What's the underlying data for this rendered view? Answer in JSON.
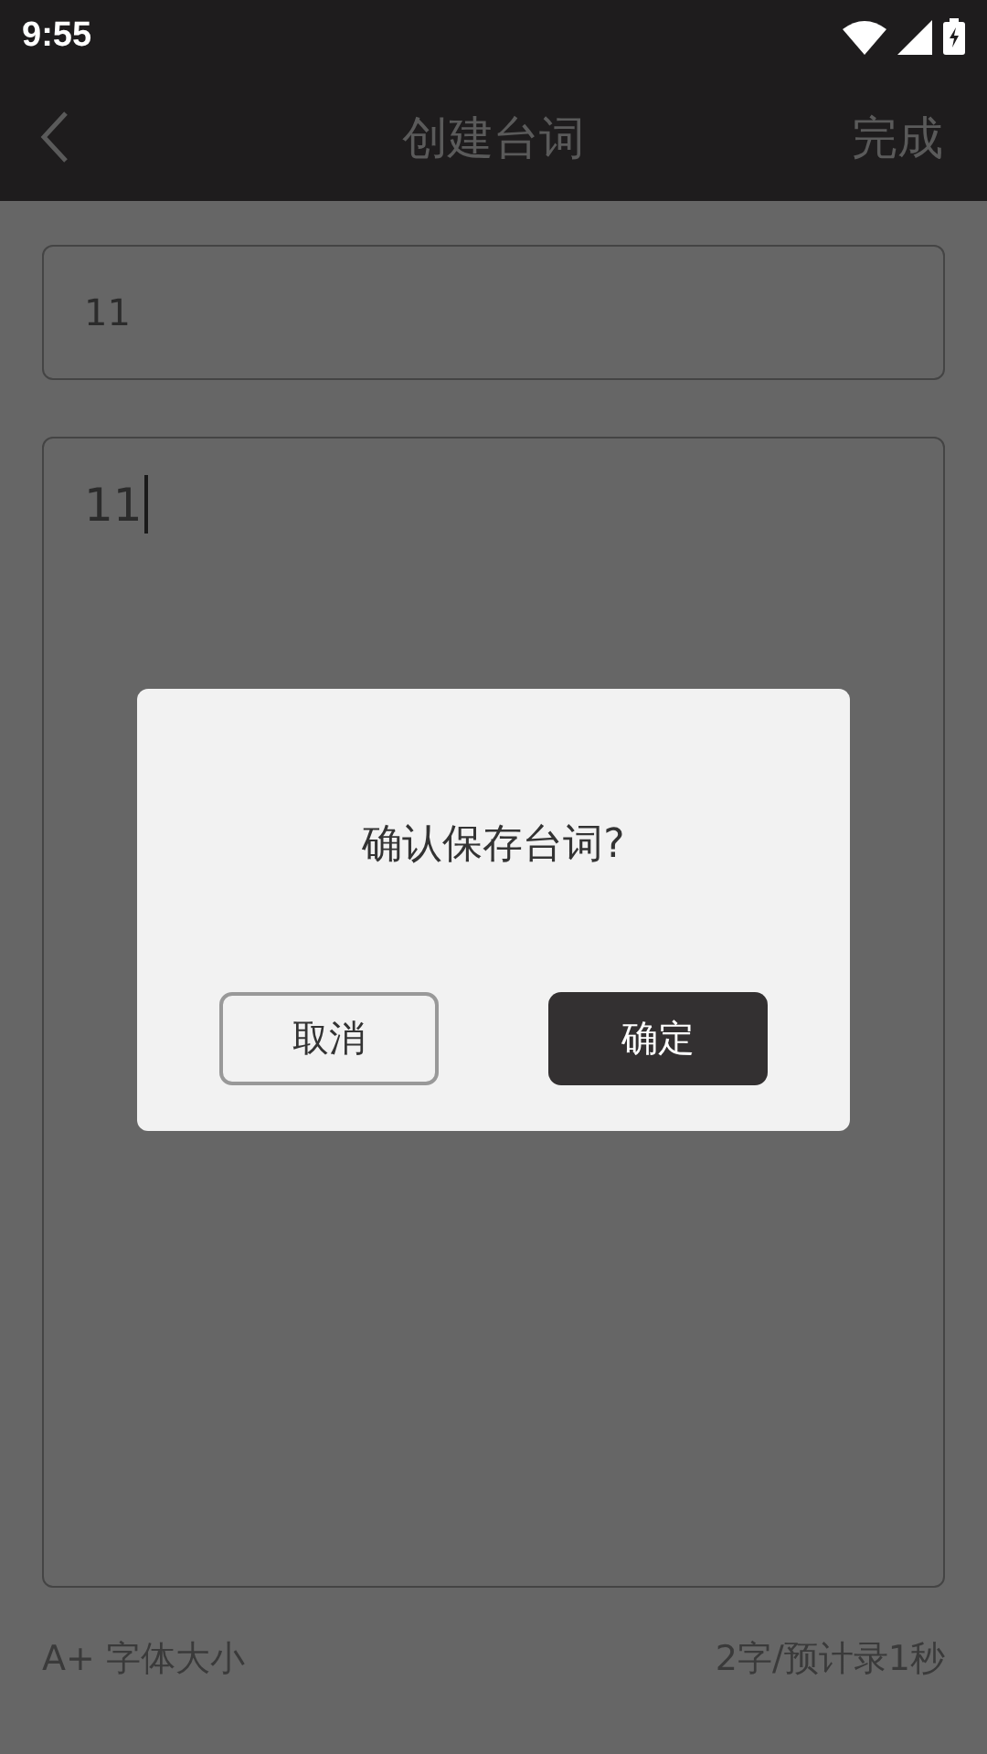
{
  "status_bar": {
    "time": "9:55"
  },
  "nav": {
    "title": "创建台词",
    "action": "完成"
  },
  "title_field": {
    "value": "11"
  },
  "content_field": {
    "value": "11",
    "focused": true
  },
  "footer": {
    "font_size": "A+ 字体大小",
    "count": "2字/预计录1秒"
  },
  "dialog": {
    "message": "确认保存台词?",
    "buttons": [
      {
        "label": "取消",
        "kind": "secondary"
      },
      {
        "label": "确定",
        "kind": "primary"
      }
    ]
  }
}
